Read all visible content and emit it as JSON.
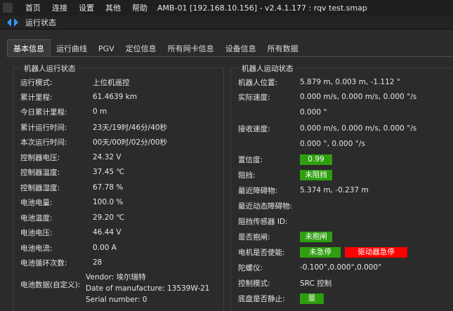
{
  "menubar": {
    "items": [
      "首页",
      "连接",
      "设置",
      "其他",
      "帮助"
    ],
    "title": "AMB-01 [192.168.10.156] - v2.4.1.177 : rqv test.smap"
  },
  "panel": {
    "title": "运行状态"
  },
  "tabs": [
    "基本信息",
    "运行曲线",
    "PGV",
    "定位信息",
    "所有网卡信息",
    "设备信息",
    "所有数据"
  ],
  "left": {
    "title": "机器人运行状态",
    "rows": [
      {
        "label": "运行模式:",
        "value": "上位机遥控"
      },
      {
        "label": "累计里程:",
        "value": "61.4639 km"
      },
      {
        "label": "今日累计里程:",
        "value": "0 m"
      },
      {
        "label": "累计运行时间:",
        "value": "23天/19时/46分/40秒"
      },
      {
        "label": "本次运行时间:",
        "value": "00天/00时/02分/00秒"
      },
      {
        "label": "控制器电压:",
        "value": "24.32 V"
      },
      {
        "label": "控制器温度:",
        "value": "37.45 ℃"
      },
      {
        "label": "控制器湿度:",
        "value": "67.78 %"
      },
      {
        "label": "电池电量:",
        "value": "100.0 %"
      },
      {
        "label": "电池温度:",
        "value": "29.20 ℃"
      },
      {
        "label": "电池电压:",
        "value": "46.44 V"
      },
      {
        "label": "电池电流:",
        "value": "0.00 A"
      },
      {
        "label": "电池循环次数:",
        "value": "28"
      }
    ],
    "battery_data": {
      "label": "电池数据(自定义):",
      "lines": [
        "Vendor: 埃尔瑞特",
        "Date of manufacture: 13539W-21",
        "Serial number: 0"
      ]
    }
  },
  "right": {
    "title": "机器人运动状态",
    "position": {
      "label": "机器人位置:",
      "value": "5.879 m, 0.003 m, -1.112 °"
    },
    "actual_speed": {
      "label": "实际速度:",
      "value": "0.000 m/s, 0.000 m/s, 0.000 °/s",
      "value2": "0.000 °"
    },
    "receive_speed": {
      "label": "接收速度:",
      "value": "0.000 m/s, 0.000 m/s, 0.000 °/s",
      "value2": "0.000 °, 0.000 °/s"
    },
    "confidence": {
      "label": "置信度:",
      "value": "0.99"
    },
    "blocked": {
      "label": "阻挡:",
      "value": "未阻挡"
    },
    "nearest_obstacle": {
      "label": "最近障碍物:",
      "value": "5.374 m, -0.237 m"
    },
    "nearest_dynamic_obstacle": {
      "label": "最近动态障碍物:",
      "value": ""
    },
    "block_sensor": {
      "label": "阻挡传感器 ID:",
      "value": ""
    },
    "brake": {
      "label": "是否抱闸:",
      "value": "未抱闸"
    },
    "motor_enabled": {
      "label": "电机是否使能:",
      "value": "未急停",
      "value2": "驱动器急停"
    },
    "gyro": {
      "label": "陀螺仪:",
      "value": "-0.100°,0.000°,0.000°"
    },
    "control_mode": {
      "label": "控制模式:",
      "value": "SRC 控制"
    },
    "chassis_still": {
      "label": "底盘是否静止:",
      "value": "是"
    }
  },
  "colors": {
    "green": "#2e9e0f",
    "red": "#ff0000",
    "accent": "#3399ff"
  }
}
